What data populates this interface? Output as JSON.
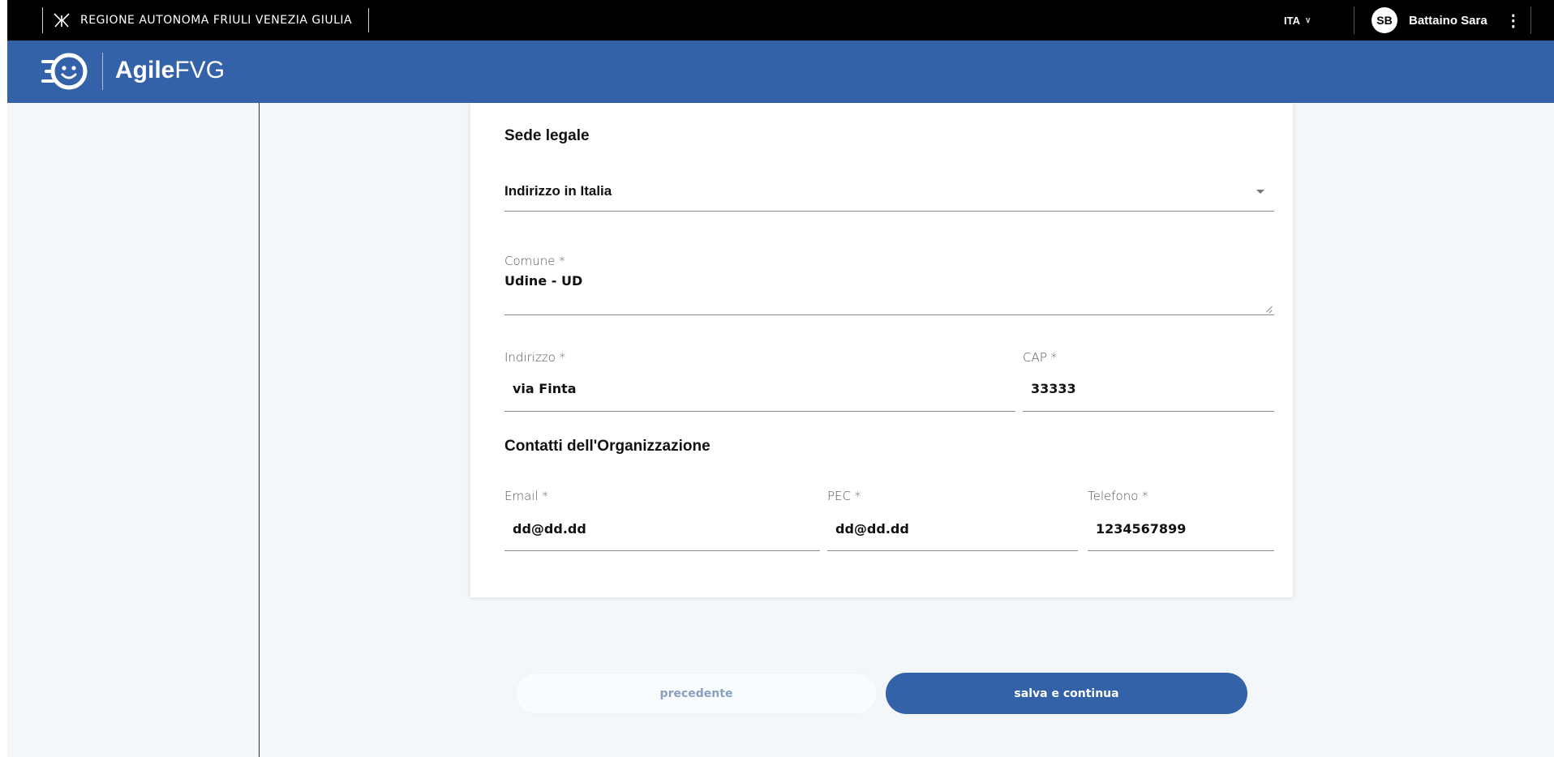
{
  "topbar": {
    "region_name": "REGIONE AUTONOMA FRIULI VENEZIA GIULIA",
    "language": "ITA",
    "user_initials": "SB",
    "user_name": "Battaino Sara"
  },
  "app": {
    "title_bold": "Agile",
    "title_regular": "FVG"
  },
  "form": {
    "sede_legale_title": "Sede legale",
    "address_type_selected": "Indirizzo in Italia",
    "comune": {
      "label": "Comune *",
      "value": "Udine - UD"
    },
    "indirizzo": {
      "label": "Indirizzo *",
      "value": "via Finta"
    },
    "cap": {
      "label": "CAP *",
      "value": "33333"
    },
    "contatti_title": "Contatti dell'Organizzazione",
    "email": {
      "label": "Email *",
      "value": "dd@dd.dd"
    },
    "pec": {
      "label": "PEC *",
      "value": "dd@dd.dd"
    },
    "telefono": {
      "label": "Telefono *",
      "value": "1234567899"
    }
  },
  "actions": {
    "prev_label": "precedente",
    "next_label": "salva e continua"
  },
  "colors": {
    "brand_blue": "#3462a8",
    "topbar_black": "#000000"
  }
}
